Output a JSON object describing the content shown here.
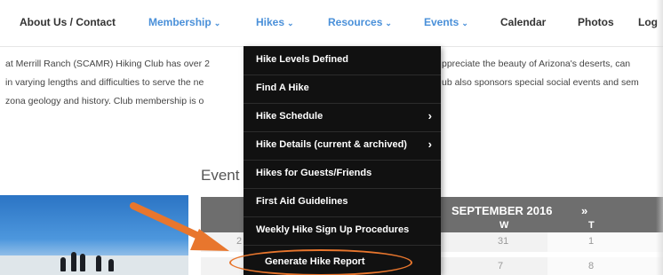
{
  "nav": {
    "items": [
      {
        "label": "About Us / Contact",
        "has_menu": false
      },
      {
        "label": "Membership",
        "has_menu": true
      },
      {
        "label": "Hikes",
        "has_menu": true,
        "active": true
      },
      {
        "label": "Resources",
        "has_menu": true
      },
      {
        "label": "Events",
        "has_menu": true
      },
      {
        "label": "Calendar",
        "has_menu": false
      },
      {
        "label": "Photos",
        "has_menu": false
      },
      {
        "label": "Log",
        "has_menu": false
      }
    ],
    "chevron": "⌄"
  },
  "intro": {
    "left_lines": [
      "at Merrill Ranch (SCAMR) Hiking Club has over 2",
      "in varying lengths and difficulties to serve the ne",
      "zona geology and history.  Club membership is o"
    ],
    "right_lines": [
      "ppreciate the beauty of Arizona's deserts, can",
      "ub also sponsors special social events and sem"
    ]
  },
  "events_heading": "Event",
  "calendar": {
    "title": "SEPTEMBER 2016",
    "next": "»",
    "days": [
      "W",
      "T"
    ],
    "rows": [
      [
        "2",
        "31",
        "1"
      ],
      [
        "",
        "7",
        "8"
      ]
    ]
  },
  "hikes_menu": {
    "items": [
      {
        "label": "Hike Levels Defined",
        "submenu": false
      },
      {
        "label": "Find A Hike",
        "submenu": false
      },
      {
        "label": "Hike Schedule",
        "submenu": true
      },
      {
        "label": "Hike Details (current & archived)",
        "submenu": true
      },
      {
        "label": "Hikes for Guests/Friends",
        "submenu": false
      },
      {
        "label": "First Aid Guidelines",
        "submenu": false
      },
      {
        "label": "Weekly Hike Sign Up Procedures",
        "submenu": false
      },
      {
        "label": "Generate Hike Report",
        "submenu": false,
        "highlighted": true
      }
    ],
    "submenu_arrow": "›"
  },
  "colors": {
    "nav_blue": "#4a90d9",
    "menu_bg": "#111111",
    "annotation": "#e8762d",
    "calendar_header": "#6e6e6e"
  }
}
